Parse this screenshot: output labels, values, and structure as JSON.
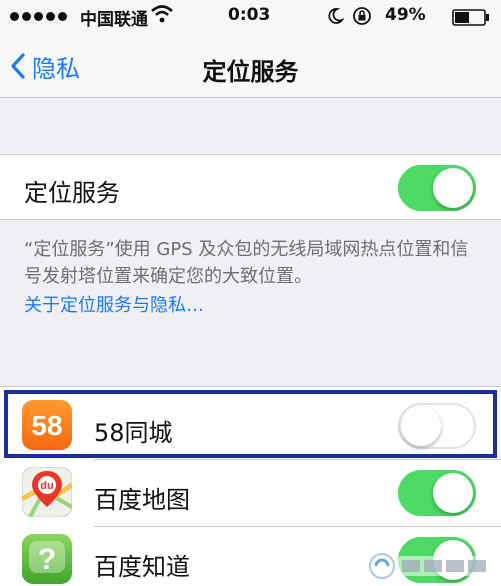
{
  "status_bar": {
    "carrier": "中国联通",
    "time": "0:03",
    "battery_percent": "49%"
  },
  "nav": {
    "back_label": "隐私",
    "title": "定位服务"
  },
  "location_services": {
    "label": "定位服务",
    "enabled": true
  },
  "footer": {
    "description": "“定位服务”使用 GPS 及众包的无线局域网热点位置和信号发射塔位置来确定您的大致位置。",
    "link": "关于定位服务与隐私…"
  },
  "apps": [
    {
      "name": "58同城",
      "icon_label": "58",
      "icon": "58-tongcheng-icon",
      "enabled": false,
      "highlighted": true
    },
    {
      "name": "百度地图",
      "icon_label": "du",
      "icon": "baidu-map-icon",
      "enabled": true
    },
    {
      "name": "百度知道",
      "icon_label": "?",
      "icon": "baidu-zhidao-icon",
      "enabled": true
    }
  ],
  "colors": {
    "accent_blue": "#1a7cf5",
    "toggle_on": "#4cd964",
    "highlight_border": "#1f2d9c",
    "background": "#efeff4"
  }
}
